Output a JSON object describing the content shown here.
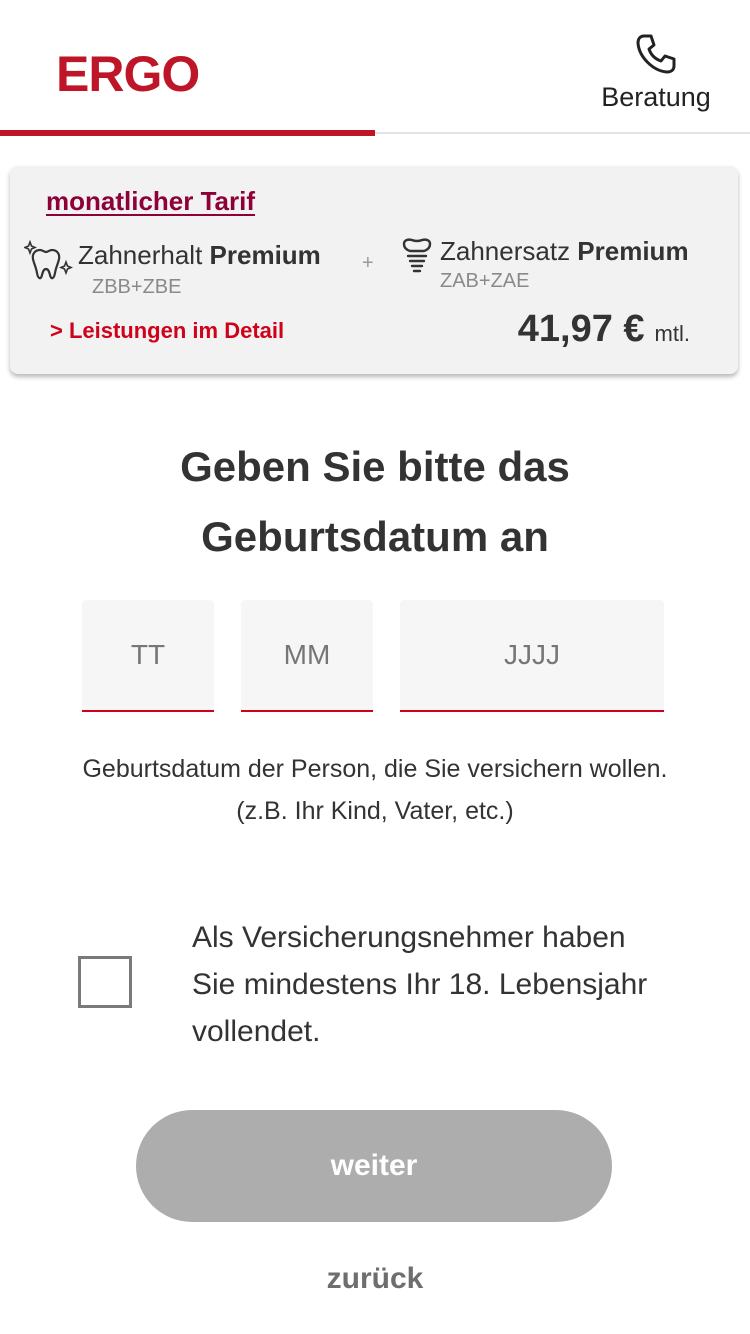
{
  "header": {
    "logo": "ERGO",
    "consult_label": "Beratung",
    "progress_fraction": 0.5,
    "accent_color": "#bf1528"
  },
  "tariff": {
    "title": "monatlicher Tarif",
    "products": [
      {
        "name_regular": "Zahnerhalt ",
        "name_bold": "Premium",
        "code": "ZBB+ZBE",
        "icon": "tooth-sparkle-icon"
      },
      {
        "name_regular": "Zahnersatz ",
        "name_bold": "Premium",
        "code": "ZAB+ZAE",
        "icon": "dental-implant-icon"
      }
    ],
    "plus": "+",
    "details_link": "> Leistungen im Detail",
    "price": "41,97 €",
    "price_unit": "mtl."
  },
  "form": {
    "heading_line1": "Geben Sie bitte das",
    "heading_line2": "Geburtsdatum an",
    "day_placeholder": "TT",
    "month_placeholder": "MM",
    "year_placeholder": "JJJJ",
    "hint": "Geburtsdatum der Person, die Sie versichern wollen. (z.B. Ihr Kind, Vater, etc.)",
    "checkbox_label": "Als Versicherungsnehmer haben Sie mindestens Ihr 18. Lebensjahr vollendet.",
    "checkbox_checked": false
  },
  "actions": {
    "next_label": "weiter",
    "back_label": "zurück"
  }
}
